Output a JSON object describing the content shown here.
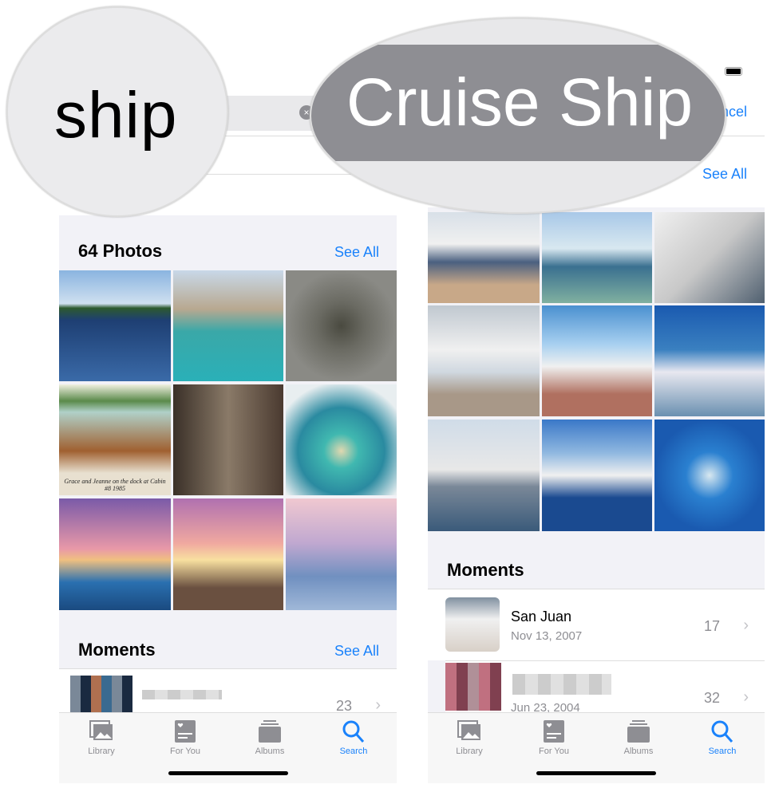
{
  "left": {
    "search_query": "ship",
    "photos_section": {
      "title": "64 Photos",
      "see_all": "See All"
    },
    "photo_caption": "Grace and Jeanne on the dock at Cabin #8 1985",
    "moments_section": {
      "title": "Moments",
      "see_all": "See All"
    },
    "moments": [
      {
        "count": "23"
      }
    ]
  },
  "right": {
    "search_query": "Cruise Ship",
    "cancel_label": "Cancel",
    "photos_section": {
      "see_all": "See All"
    },
    "moments_section": {
      "title": "Moments"
    },
    "moments": [
      {
        "title": "San Juan",
        "date": "Nov 13, 2007",
        "count": "17"
      },
      {
        "date": "Jun 23, 2004",
        "count": "32"
      }
    ]
  },
  "tabs": [
    {
      "label": "Library",
      "icon": "photo-stack-icon"
    },
    {
      "label": "For You",
      "icon": "heart-card-icon"
    },
    {
      "label": "Albums",
      "icon": "albums-icon"
    },
    {
      "label": "Search",
      "icon": "search-icon",
      "active": true
    }
  ],
  "colors": {
    "accent": "#1a82fb",
    "background": "#f2f2f7"
  }
}
